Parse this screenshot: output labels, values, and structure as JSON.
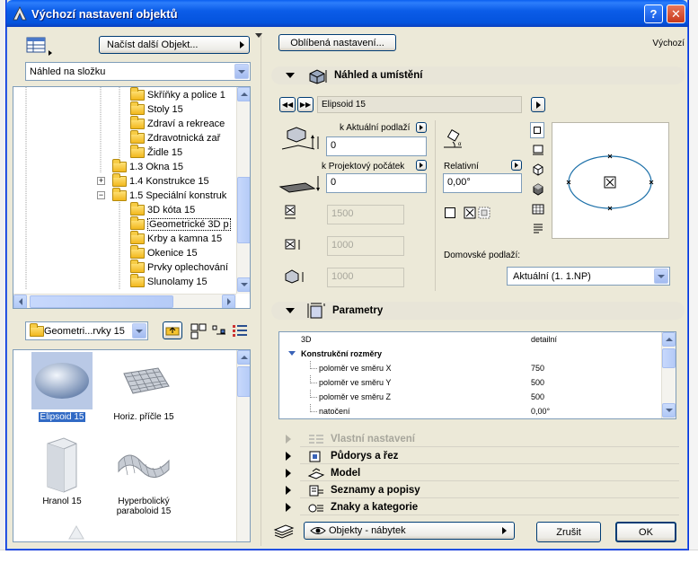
{
  "window": {
    "title": "Výchozí nastavení objektů",
    "help_label": "?",
    "close_label": "✕"
  },
  "left": {
    "load_button": "Načíst další Objekt...",
    "view_select": "Náhled na složku",
    "tree": [
      {
        "label": "Skříňky a police 1",
        "indent": 3
      },
      {
        "label": "Stoly 15",
        "indent": 3
      },
      {
        "label": "Zdraví a rekreace",
        "indent": 3
      },
      {
        "label": "Zdravotnická zař",
        "indent": 3
      },
      {
        "label": "Židle 15",
        "indent": 3
      },
      {
        "label": "1.3 Okna 15",
        "indent": 2,
        "expander": ""
      },
      {
        "label": "1.4 Konstrukce 15",
        "indent": 2,
        "expander": "+"
      },
      {
        "label": "1.5 Speciální konstruk",
        "indent": 2,
        "expander": "−"
      },
      {
        "label": "3D kóta 15",
        "indent": 3
      },
      {
        "label": "Geometrické 3D p",
        "indent": 3,
        "selected": true
      },
      {
        "label": "Krby a kamna 15",
        "indent": 3
      },
      {
        "label": "Okenice 15",
        "indent": 3
      },
      {
        "label": "Prvky oplechování",
        "indent": 3
      },
      {
        "label": "Slunolamy 15",
        "indent": 3
      }
    ],
    "folder_select": "Geometri...rvky 15",
    "thumbnails": [
      {
        "label": "Elipsoid 15",
        "selected": true
      },
      {
        "label": "Horiz. příčle 15",
        "selected": false
      },
      {
        "label": "Hranol 15",
        "selected": false
      },
      {
        "label": "Hyperbolický paraboloid 15",
        "selected": false
      }
    ]
  },
  "right": {
    "favorites_button": "Oblíbená nastavení...",
    "default_label": "Výchozí",
    "section_preview": "Náhled a umístění",
    "object_name": "Elipsoid 15",
    "current_floor_label": "k Aktuální podlaží",
    "current_floor_value": "0",
    "project_origin_label": "k Projektový počátek",
    "project_origin_value": "0",
    "relative_label": "Relativní",
    "relative_value": "0,00°",
    "dim1": "1500",
    "dim2": "1000",
    "dim3": "1000",
    "home_floor_label": "Domovské podlaží:",
    "home_floor_value": "Aktuální (1. 1.NP)",
    "section_params": "Parametry",
    "params": [
      {
        "name": "3D",
        "value": "detailní",
        "level": 0,
        "bold": false
      },
      {
        "name": "Konstrukční rozměry",
        "value": "",
        "level": 0,
        "bold": true,
        "group": true
      },
      {
        "name": "poloměr ve směru X",
        "value": "750",
        "level": 1,
        "bold": false
      },
      {
        "name": "poloměr ve směru Y",
        "value": "500",
        "level": 1,
        "bold": false
      },
      {
        "name": "poloměr ve směru Z",
        "value": "500",
        "level": 1,
        "bold": false
      },
      {
        "name": "natočení",
        "value": "0,00°",
        "level": 1,
        "bold": false
      }
    ],
    "categories": [
      {
        "label": "Vlastní nastavení",
        "disabled": true
      },
      {
        "label": "Půdorys a řez",
        "disabled": false
      },
      {
        "label": "Model",
        "disabled": false
      },
      {
        "label": "Seznamy a popisy",
        "disabled": false
      },
      {
        "label": "Znaky a kategorie",
        "disabled": false
      }
    ],
    "layer_select": "Objekty - nábytek",
    "cancel_button": "Zrušit",
    "ok_button": "OK"
  },
  "colors": {
    "titlebar": "#0a5ff0",
    "dialog_bg": "#ece9d8",
    "selection": "#316ac5",
    "ellipse": "#1b6fa8"
  }
}
